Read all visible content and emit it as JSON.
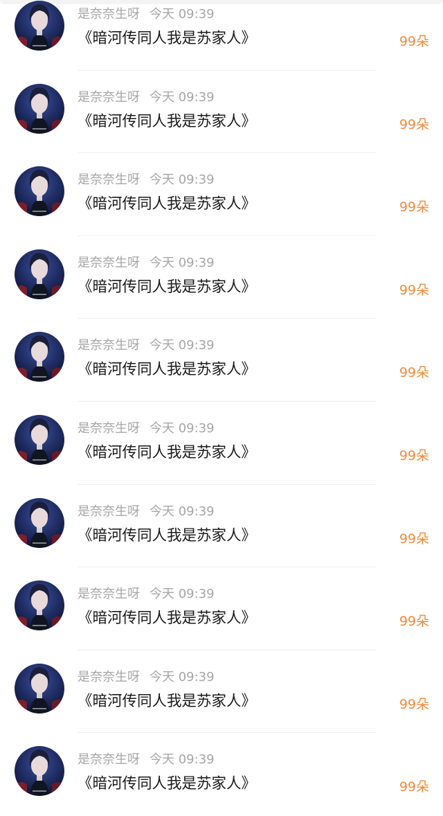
{
  "rows": [
    {
      "username": "是奈奈生呀",
      "time": "今天 09:39",
      "title": "《暗河传同人我是苏家人》",
      "amount": "99朵",
      "avatar_icon": "avatar-anime-character-icon"
    },
    {
      "username": "是奈奈生呀",
      "time": "今天 09:39",
      "title": "《暗河传同人我是苏家人》",
      "amount": "99朵",
      "avatar_icon": "avatar-anime-character-icon"
    },
    {
      "username": "是奈奈生呀",
      "time": "今天 09:39",
      "title": "《暗河传同人我是苏家人》",
      "amount": "99朵",
      "avatar_icon": "avatar-anime-character-icon"
    },
    {
      "username": "是奈奈生呀",
      "time": "今天 09:39",
      "title": "《暗河传同人我是苏家人》",
      "amount": "99朵",
      "avatar_icon": "avatar-anime-character-icon"
    },
    {
      "username": "是奈奈生呀",
      "time": "今天 09:39",
      "title": "《暗河传同人我是苏家人》",
      "amount": "99朵",
      "avatar_icon": "avatar-anime-character-icon"
    },
    {
      "username": "是奈奈生呀",
      "time": "今天 09:39",
      "title": "《暗河传同人我是苏家人》",
      "amount": "99朵",
      "avatar_icon": "avatar-anime-character-icon"
    },
    {
      "username": "是奈奈生呀",
      "time": "今天 09:39",
      "title": "《暗河传同人我是苏家人》",
      "amount": "99朵",
      "avatar_icon": "avatar-anime-character-icon"
    },
    {
      "username": "是奈奈生呀",
      "time": "今天 09:39",
      "title": "《暗河传同人我是苏家人》",
      "amount": "99朵",
      "avatar_icon": "avatar-anime-character-icon"
    },
    {
      "username": "是奈奈生呀",
      "time": "今天 09:39",
      "title": "《暗河传同人我是苏家人》",
      "amount": "99朵",
      "avatar_icon": "avatar-anime-character-icon"
    },
    {
      "username": "是奈奈生呀",
      "time": "今天 09:39",
      "title": "《暗河传同人我是苏家人》",
      "amount": "99朵",
      "avatar_icon": "avatar-anime-character-icon"
    }
  ],
  "colors": {
    "accent_amount": "#f08a3c",
    "meta_text": "#a6a6a6",
    "title_text": "#1a1a1a",
    "divider": "#efefef"
  }
}
